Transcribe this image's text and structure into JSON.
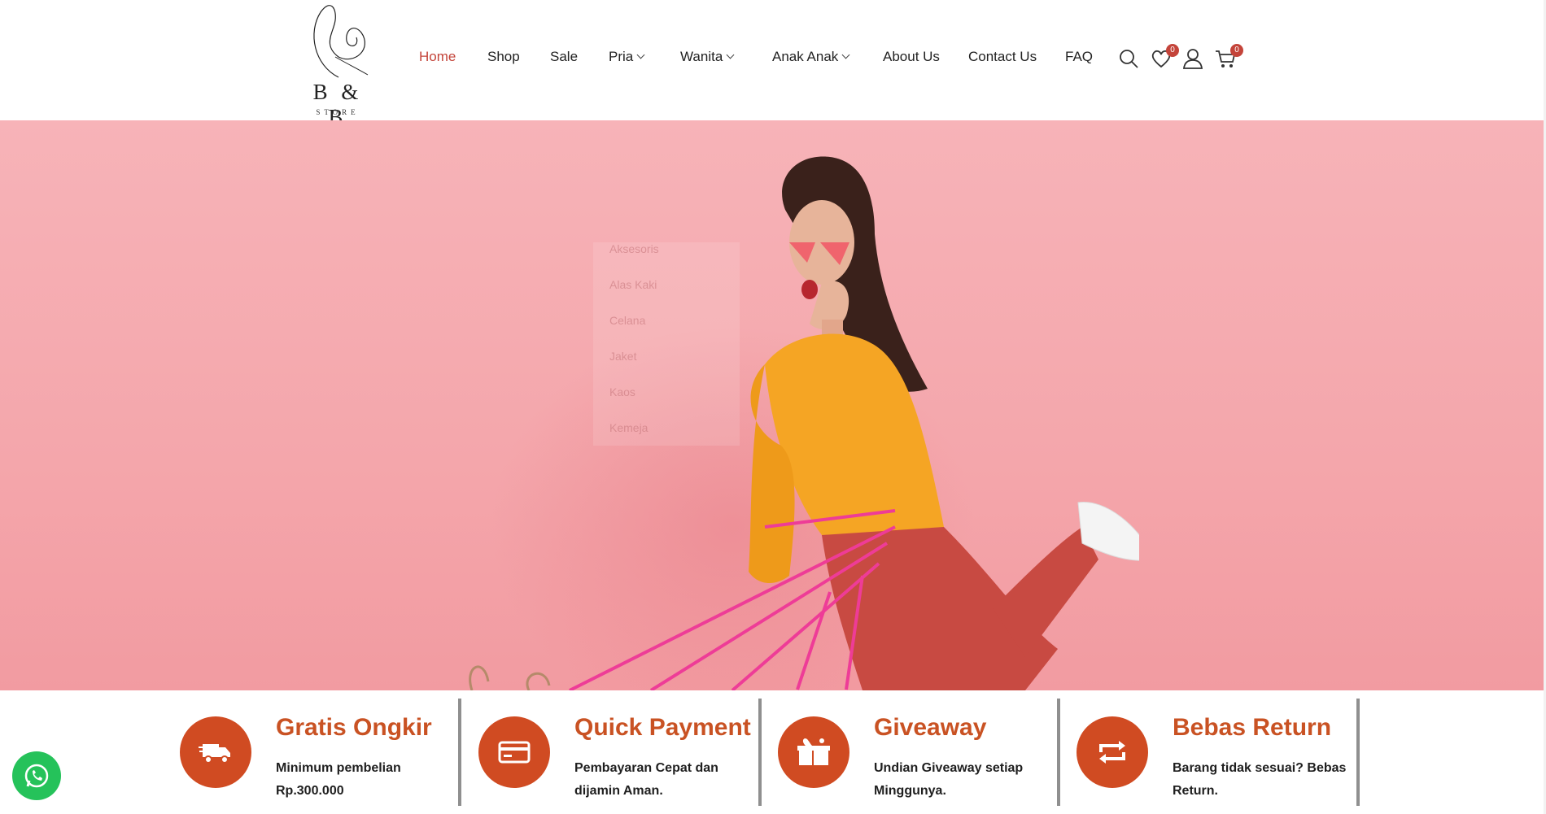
{
  "logo": {
    "main": "B & B",
    "sub": "STORE"
  },
  "nav": {
    "home": "Home",
    "shop": "Shop",
    "sale": "Sale",
    "pria": "Pria",
    "wanita": "Wanita",
    "anak": "Anak Anak",
    "about": "About Us",
    "contact": "Contact Us",
    "faq": "FAQ",
    "accent_color": "#c4443a"
  },
  "header_icons": {
    "search": "search-icon",
    "wishlist": "heart-icon",
    "wishlist_count": "0",
    "account": "user-icon",
    "cart": "cart-icon",
    "cart_count": "0"
  },
  "dropdown": {
    "items": [
      "Aksesoris",
      "Alas Kaki",
      "Celana",
      "Jaket",
      "Kaos",
      "Kemeja"
    ]
  },
  "features": [
    {
      "icon": "truck-icon",
      "title": "Gratis Ongkir",
      "desc": "Minimum pembelian Rp.300.000"
    },
    {
      "icon": "credit-card-icon",
      "title": "Quick Payment",
      "desc": "Pembayaran Cepat dan dijamin Aman."
    },
    {
      "icon": "gift-icon",
      "title": "Giveaway",
      "desc": "Undian Giveaway setiap Minggunya."
    },
    {
      "icon": "return-icon",
      "title": "Bebas Return",
      "desc": "Barang tidak sesuai? Bebas Return."
    }
  ],
  "colors": {
    "feature_accent": "#d04b22",
    "hero_bg": "#f4a6ab",
    "whatsapp": "#25c25a"
  }
}
